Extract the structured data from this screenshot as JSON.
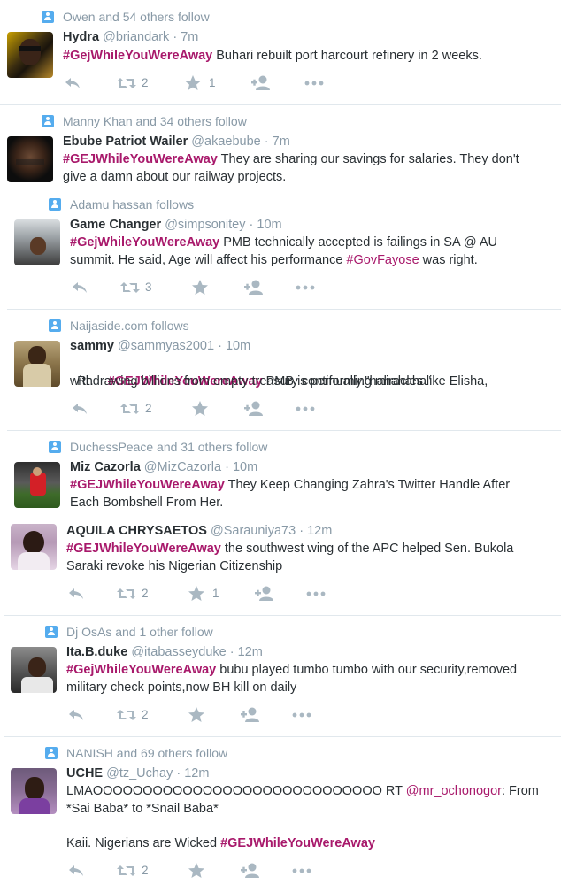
{
  "tweets": [
    {
      "context": "Owen and 54 others follow",
      "name": "Hydra",
      "handle": "@briandark",
      "dot": "·",
      "time": "7m",
      "hashtag": "#GejWhileYouWereAway",
      "text": " Buhari rebuilt port harcourt refinery in 2 weeks.",
      "retweets": "2",
      "favorites": "1"
    },
    {
      "context": "Manny Khan and 34 others follow",
      "name": "Ebube Patriot Wailer",
      "handle": "@akaebube",
      "dot": "·",
      "time": "7m",
      "hashtag": "#GEJWhileYouWereAway",
      "text1": " They are sharing our savings for salaries. They don't",
      "text2": "give a damn about our railway projects."
    },
    {
      "context": "Adamu hassan follows",
      "name": "Game Changer",
      "handle": "@simpsonitey",
      "dot": "·",
      "time": "10m",
      "hashtag": "#GejWhileYouWereAway",
      "text1": "  PMB technically accepted is failings in SA @ AU",
      "text2": "summit. He said, Age will affect his performance ",
      "hashtag2": "#GovFayose",
      "text3": " was right.",
      "retweets": "3"
    },
    {
      "context": "Naijaside.com follows",
      "name": "sammy",
      "handle": "@sammyas2001",
      "dot": "·",
      "time": "10m",
      "prefix": "Rt.    ",
      "hashtag": "#GEJWhileYouWereAway",
      "text1": " PMB is performing miracles like Elisha,",
      "text2": "withdrawing billions from empty treasury continually.\"hahahaha\"",
      "retweets": "2"
    },
    {
      "context": "DuchessPeace and 31 others follow",
      "name": "Miz Cazorla",
      "handle": "@MizCazorla",
      "dot": "·",
      "time": "10m",
      "hashtag": "#GEJWhileYouWereAway",
      "text1": " They Keep Changing Zahra's Twitter Handle After",
      "text2": "Each Bombshell From Her."
    },
    {
      "name": "AQUILA CHRYSAETOS",
      "handle": "@Sarauniya73",
      "dot": "·",
      "time": "12m",
      "hashtag": "#GEJWhileYouWereAway",
      "text1": " the southwest wing of the APC helped Sen. Bukola",
      "text2": "Saraki revoke his Nigerian Citizenship",
      "retweets": "2",
      "favorites": "1"
    },
    {
      "context": "Dj OsAs and 1 other follow",
      "name": "Ita.B.duke",
      "handle": "@itabasseyduke",
      "dot": "·",
      "time": "12m",
      "hashtag": "#GejWhileYouWereAway",
      "text1": " bubu played tumbo tumbo with our security,removed",
      "text2": "military check points,now BH kill on daily",
      "retweets": "2"
    },
    {
      "context": "NANISH and 69 others follow",
      "name": "UCHE",
      "handle": "@tz_Uchay",
      "dot": "·",
      "time": "12m",
      "text1": "LMAOOOOOOOOOOOOOOOOOOOOOOOOOOOOO RT ",
      "mention": "@mr_ochonogor",
      "text1b": ": From",
      "text2": "*Sai Baba* to *Snail Baba*",
      "text3": "Kaii. Nigerians are Wicked ",
      "hashtag": "#GEJWhileYouWereAway",
      "retweets": "2"
    }
  ],
  "icons": {
    "context": "follow-badge-icon",
    "reply": "reply-icon",
    "retweet": "retweet-icon",
    "favorite": "star-icon",
    "follow": "follow-user-icon",
    "more": "more-dots-icon"
  },
  "colors": {
    "hashtag": "#a8196b",
    "muted": "#8899a6",
    "icon": "#aab8c2",
    "badge": "#55acee"
  }
}
